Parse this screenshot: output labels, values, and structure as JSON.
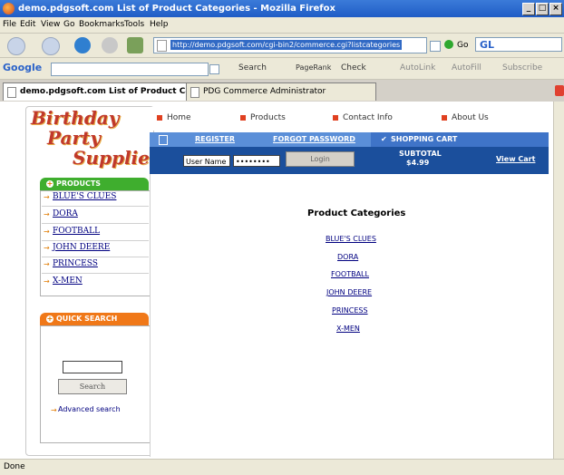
{
  "window": {
    "title": "demo.pdgsoft.com List of Product Categories - Mozilla Firefox"
  },
  "menu": [
    "File",
    "Edit",
    "View",
    "Go",
    "Bookmarks",
    "Tools",
    "Help"
  ],
  "toolbar": {
    "url": "http://demo.pdgsoft.com/cgi-bin2/commerce.cgi?listcategories",
    "go_label": "Go",
    "search_value": "GL"
  },
  "google_bar": {
    "brand": "Google",
    "search_label": "Search",
    "pagerank_label": "PageRank",
    "check_label": "Check",
    "autolink_label": "AutoLink",
    "autofill_label": "AutoFill",
    "subscribe_label": "Subscribe"
  },
  "tabs": [
    {
      "label": "demo.pdgsoft.com List of Product Ca..."
    },
    {
      "label": "PDG Commerce Administrator"
    }
  ],
  "logo": {
    "line1": "Birthday",
    "line2": "Party",
    "line3": "Supplies"
  },
  "products_panel": {
    "heading": "PRODUCTS",
    "items": [
      "BLUE'S CLUES",
      "DORA",
      "FOOTBALL",
      "JOHN DEERE",
      "PRINCESS",
      "X-MEN"
    ]
  },
  "quick_search": {
    "heading": "QUICK SEARCH",
    "input_value": "",
    "button_label": "Search",
    "advanced_label": "Advanced search"
  },
  "topnav": [
    "Home",
    "Products",
    "Contact Info",
    "About Us"
  ],
  "account": {
    "register_label": "REGISTER",
    "forgot_label": "FORGOT PASSWORD",
    "cart_label": "SHOPPING CART",
    "username_value": "User Name",
    "password_value": "••••••••",
    "login_label": "Login",
    "subtotal_label": "SUBTOTAL",
    "subtotal_value": "$4.99",
    "view_cart_label": "View Cart"
  },
  "main": {
    "title": "Product Categories",
    "categories": [
      "BLUE'S CLUES",
      "DORA",
      "FOOTBALL",
      "JOHN DEERE",
      "PRINCESS",
      "X-MEN"
    ]
  },
  "status": {
    "text": "Done"
  },
  "colors": {
    "products_head": "#3fae2e",
    "search_head": "#f07818",
    "bluebar": "#5b8fd8",
    "loginbar": "#1b4f9c"
  }
}
